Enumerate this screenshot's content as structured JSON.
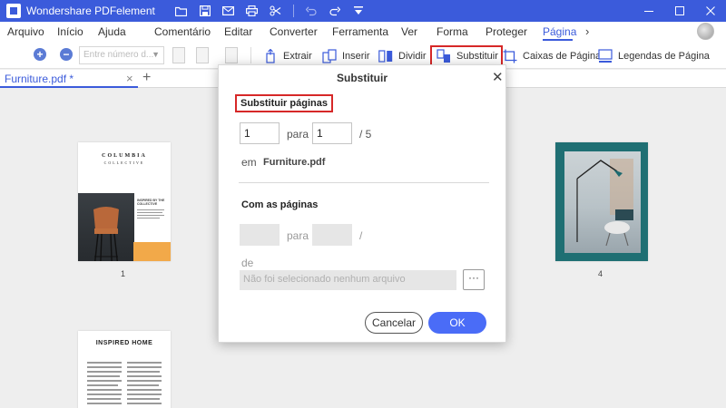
{
  "app": {
    "title": "Wondershare PDFelement",
    "quick_access_icons": [
      "folder-open-icon",
      "save-icon",
      "mail-icon",
      "print-icon",
      "scissors-icon",
      "undo-icon",
      "redo-icon",
      "dropdown-icon"
    ],
    "window_controls": [
      "minimize-icon",
      "maximize-icon",
      "close-icon"
    ],
    "accent_color": "#3b5bdb"
  },
  "menu": {
    "items": [
      "Arquivo",
      "Início",
      "Ajuda",
      "Comentário",
      "Editar",
      "Converter",
      "Ferramenta",
      "Ver",
      "Forma",
      "Proteger",
      "Página"
    ],
    "active": "Página"
  },
  "toolbar": {
    "page_input_placeholder": "Entre número d...",
    "extract_label": "Extrair",
    "insert_label": "Inserir",
    "split_label": "Dividir",
    "replace_label": "Substituir",
    "page_boxes_label": "Caixas de Página",
    "page_labels_label": "Legendas de Página"
  },
  "tabs": {
    "doc_tab_label": "Furniture.pdf *"
  },
  "document": {
    "pages": [
      {
        "number": "1",
        "brand_line1": "COLUMBIA",
        "brand_line2": "COLLECTIVE",
        "side_text": "INSPIRED BY THE COLLECTIVE"
      },
      {
        "number": "4"
      },
      {
        "title": "INSPIRED HOME"
      }
    ]
  },
  "dialog": {
    "title": "Substituir",
    "section1_title": "Substituir páginas",
    "from_page": "1",
    "connector": "para",
    "to_page": "1",
    "total_pages": "/ 5",
    "in_label": "em",
    "file_name": "Furniture.pdf",
    "section2_title": "Com as páginas",
    "connector2": "para",
    "slash": "/",
    "from_label": "de",
    "no_file_placeholder": "Não foi selecionado nenhum arquivo",
    "browse_label": "···",
    "cancel_label": "Cancelar",
    "ok_label": "OK",
    "ok_color": "#4a6cf7",
    "highlight_color": "#d62828"
  }
}
